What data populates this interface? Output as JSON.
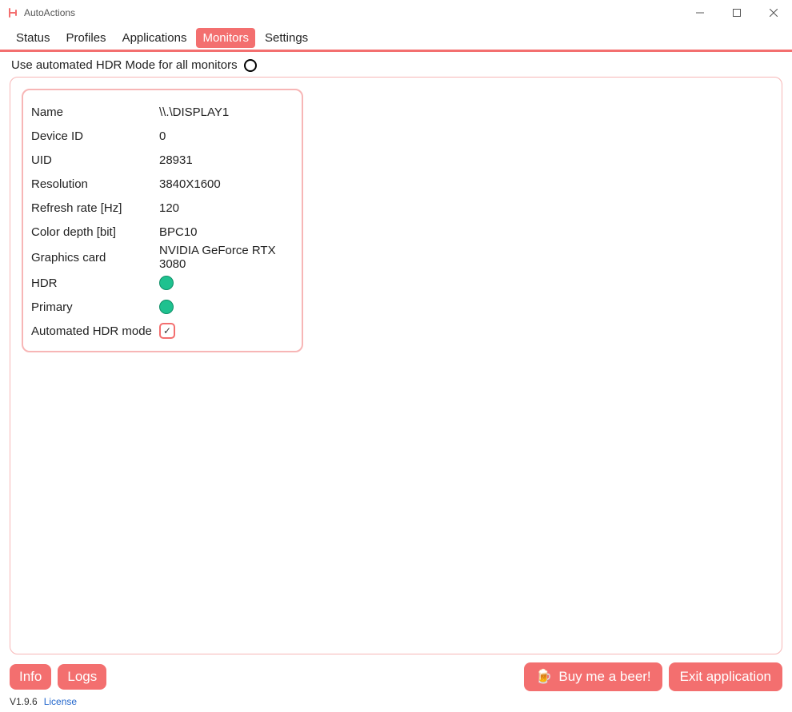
{
  "app": {
    "title": "AutoActions"
  },
  "tabs": [
    "Status",
    "Profiles",
    "Applications",
    "Monitors",
    "Settings"
  ],
  "activeTab": "Monitors",
  "hdrAllLabel": "Use automated HDR Mode for all monitors",
  "monitor": {
    "labels": {
      "name": "Name",
      "deviceId": "Device ID",
      "uid": "UID",
      "resolution": "Resolution",
      "refresh": "Refresh rate [Hz]",
      "colorDepth": "Color depth [bit]",
      "gpu": "Graphics card",
      "hdr": "HDR",
      "primary": "Primary",
      "autoHdr": "Automated HDR mode"
    },
    "values": {
      "name": "\\\\.\\DISPLAY1",
      "deviceId": "0",
      "uid": "28931",
      "resolution": "3840X1600",
      "refresh": "120",
      "colorDepth": "BPC10",
      "gpu": "NVIDIA GeForce RTX 3080"
    }
  },
  "buttons": {
    "info": "Info",
    "logs": "Logs",
    "beer": "Buy me a beer!",
    "exit": "Exit application"
  },
  "status": {
    "version": "V1.9.6",
    "license": "License"
  }
}
